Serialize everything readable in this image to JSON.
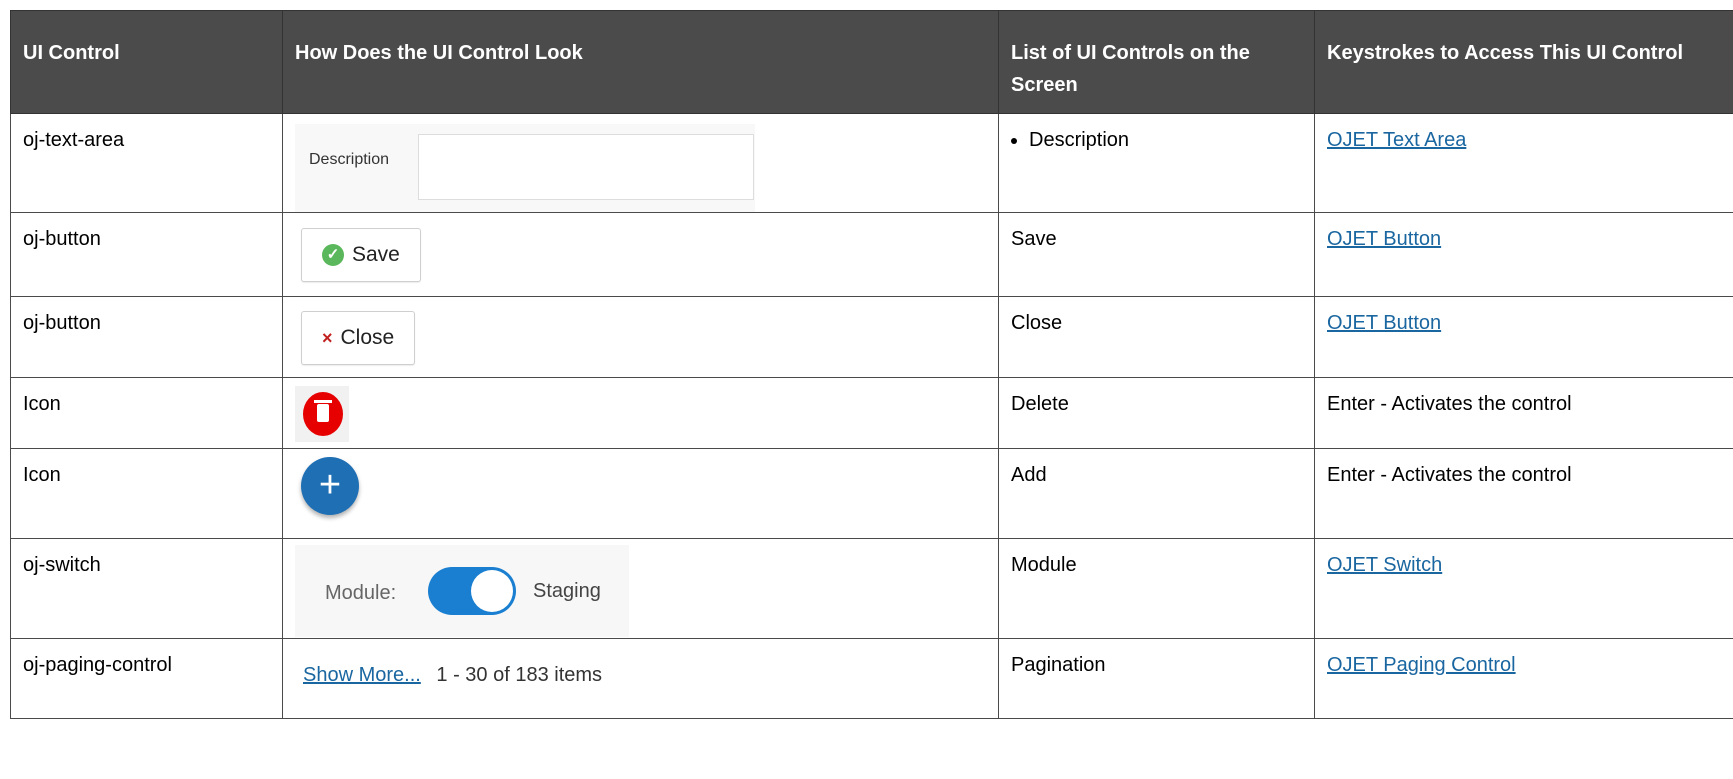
{
  "headers": {
    "col1": "UI Control",
    "col2": "How Does the UI Control Look",
    "col3": "List of UI Controls on the Screen",
    "col4": "Keystrokes to Access This UI Control"
  },
  "rows": [
    {
      "control": "oj-text-area",
      "preview": {
        "label": "Description"
      },
      "list_item": "Description",
      "keystroke": "OJET Text Area"
    },
    {
      "control": "oj-button",
      "preview": {
        "label": "Save",
        "icon": "check-circle-icon"
      },
      "list_item": "Save",
      "keystroke": "OJET Button"
    },
    {
      "control": "oj-button",
      "preview": {
        "label": "Close",
        "icon": "close-icon"
      },
      "list_item": "Close",
      "keystroke": "OJET Button"
    },
    {
      "control": "Icon",
      "preview": {
        "icon": "delete-icon"
      },
      "list_item": "Delete",
      "keystroke": "Enter - Activates the control"
    },
    {
      "control": "Icon",
      "preview": {
        "icon": "add-icon",
        "glyph": "+"
      },
      "list_item": "Add",
      "keystroke": "Enter - Activates the control"
    },
    {
      "control": "oj-switch",
      "preview": {
        "label": "Module:",
        "state": "Staging"
      },
      "list_item": "Module",
      "keystroke": "OJET Switch"
    },
    {
      "control": "oj-paging-control",
      "preview": {
        "link": "Show More...",
        "range": "1 - 30 of 183 items"
      },
      "list_item": "Pagination",
      "keystroke": "OJET Paging Control"
    }
  ],
  "colors": {
    "header_bg": "#4b4b4b",
    "link": "#1a66a0",
    "switch_on": "#1a7fd0",
    "delete_red": "#e60000",
    "add_blue": "#1f6fb5"
  }
}
